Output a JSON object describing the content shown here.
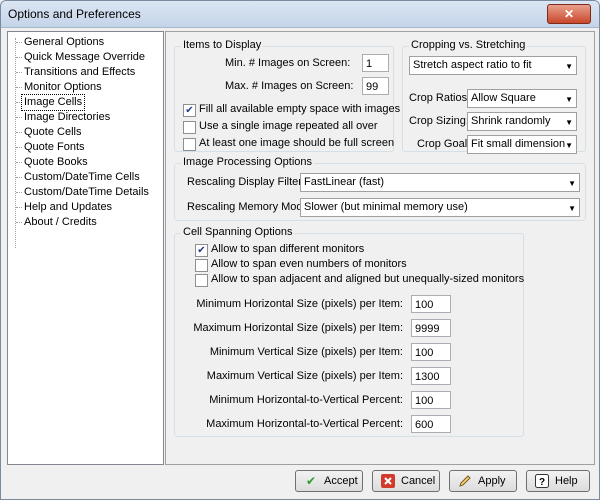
{
  "window": {
    "title": "Options and Preferences",
    "close_glyph": "✕"
  },
  "tree": {
    "items": [
      {
        "label": "General Options"
      },
      {
        "label": "Quick Message Override"
      },
      {
        "label": "Transitions and Effects"
      },
      {
        "label": "Monitor Options"
      },
      {
        "label": "Image Cells",
        "selected": true
      },
      {
        "label": "Image Directories"
      },
      {
        "label": "Quote Cells"
      },
      {
        "label": "Quote Fonts"
      },
      {
        "label": "Quote Books"
      },
      {
        "label": "Custom/DateTime Cells"
      },
      {
        "label": "Custom/DateTime Details"
      },
      {
        "label": "Help and Updates"
      },
      {
        "label": "About / Credits"
      }
    ]
  },
  "items_to_display": {
    "label": "Items to Display",
    "min_images_label": "Min. # Images on Screen:",
    "min_images_value": "1",
    "max_images_label": "Max. # Images on Screen:",
    "max_images_value": "99",
    "fill_space_label": "Fill all available empty space with images",
    "fill_space_checked": true,
    "single_image_label": "Use a single image repeated all over",
    "single_image_checked": false,
    "full_screen_label": "At least one image should be full screen",
    "full_screen_checked": false
  },
  "cropping": {
    "label": "Cropping vs. Stretching",
    "mode_value": "Stretch aspect ratio to fit",
    "crop_ratios_label": "Crop Ratios:",
    "crop_ratios_value": "Allow Square",
    "crop_sizing_label": "Crop Sizing:",
    "crop_sizing_value": "Shrink randomly",
    "crop_goal_label": "Crop Goal:",
    "crop_goal_value": "Fit small dimension"
  },
  "image_processing": {
    "label": "Image Processing Options",
    "display_filter_label": "Rescaling Display Filter",
    "display_filter_value": "FastLinear (fast)",
    "memory_mode_label": "Rescaling Memory Mode",
    "memory_mode_value": "Slower (but minimal memory use)"
  },
  "cell_spanning": {
    "label": "Cell Spanning Options",
    "span_monitors_label": "Allow to span different monitors",
    "span_monitors_checked": true,
    "span_even_label": "Allow to span even numbers of monitors",
    "span_even_checked": false,
    "span_adjacent_label": "Allow to span adjacent and aligned but unequally-sized monitors",
    "span_adjacent_checked": false,
    "min_h_label": "Minimum Horizontal Size (pixels) per Item:",
    "min_h_value": "100",
    "max_h_label": "Maximum Horizontal Size (pixels) per Item:",
    "max_h_value": "9999",
    "min_v_label": "Minimum Vertical Size (pixels) per Item:",
    "min_v_value": "100",
    "max_v_label": "Maximum Vertical Size (pixels) per Item:",
    "max_v_value": "1300",
    "min_hv_label": "Minimum Horizontal-to-Vertical  Percent:",
    "min_hv_value": "100",
    "max_hv_label": "Maximum Horizontal-to-Vertical  Percent:",
    "max_hv_value": "600"
  },
  "buttons": {
    "accept_label": "Accept",
    "cancel_label": "Cancel",
    "apply_label": "Apply",
    "help_label": "Help"
  },
  "icons": {
    "checkmark": "✔",
    "accept_icon": "checkmark-icon",
    "cancel_icon": "cancel-icon",
    "apply_icon": "pencil-icon",
    "help_icon": "question-icon"
  },
  "colors": {
    "accept_green": "#2e9a2e",
    "cancel_red": "#d23b2b",
    "selection_outline": "#000000"
  }
}
